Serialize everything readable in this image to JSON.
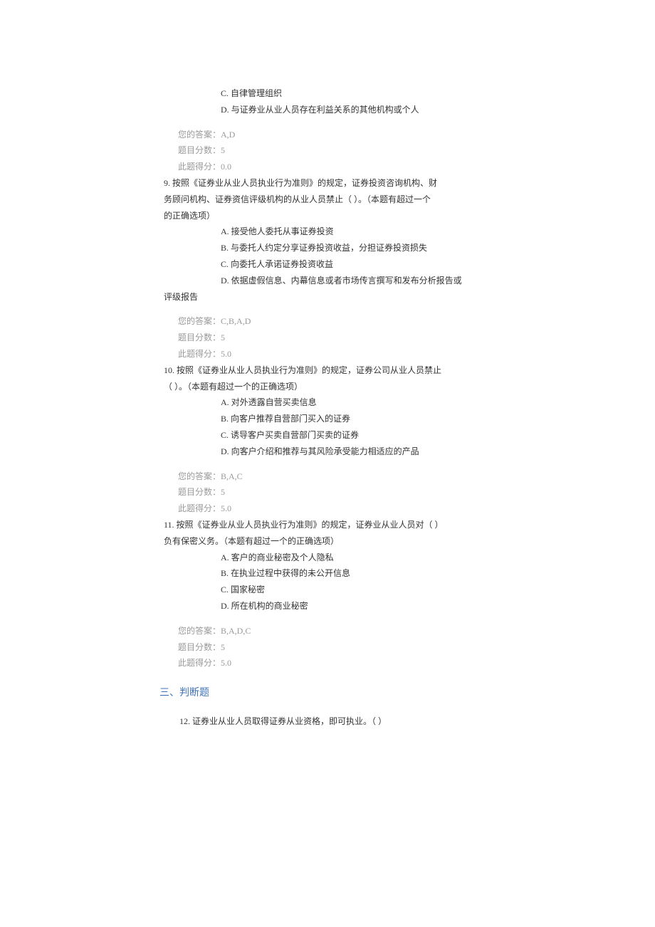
{
  "labels": {
    "your_answer": "您的答案：",
    "question_score": "题目分数：",
    "this_score": "此题得分："
  },
  "q_top_options": {
    "c": "C. 自律管理组织",
    "d": "D. 与证券业从业人员存在利益关系的其他机构或个人"
  },
  "q_top_meta": {
    "answer": "A,D",
    "score": "5",
    "got": "0.0"
  },
  "q9": {
    "line1": "9. 按照《证券业从业人员执业行为准则》的规定，证券投资咨询机构、财",
    "line2": "务顾问机构、证券资信评级机构的从业人员禁止（ ）。（本题有超过一个",
    "line3": "的正确选项）",
    "a": "A. 接受他人委托从事证券投资",
    "b": "B. 与委托人约定分享证券投资收益，分担证券投资损失",
    "c": "C. 向委托人承诺证券投资收益",
    "d": "D. 依据虚假信息、内幕信息或者市场传言撰写和发布分析报告或",
    "d_cont": "评级报告",
    "answer": "C,B,A,D",
    "score": "5",
    "got": "5.0"
  },
  "q10": {
    "line1": "10. 按照《证券业从业人员执业行为准则》的规定，证券公司从业人员禁止",
    "line2": "（ ）。（本题有超过一个的正确选项）",
    "a": "A. 对外透露自营买卖信息",
    "b": "B. 向客户推荐自营部门买入的证券",
    "c": "C. 诱导客户买卖自营部门买卖的证券",
    "d": "D. 向客户介绍和推荐与其风险承受能力相适应的产品",
    "answer": "B,A,C",
    "score": "5",
    "got": "5.0"
  },
  "q11": {
    "line1": "11. 按照《证券业从业人员执业行为准则》的规定，证券业从业人员对（  ）",
    "line2": "负有保密义务。（本题有超过一个的正确选项）",
    "a": "A. 客户的商业秘密及个人隐私",
    "b": "B. 在执业过程中获得的未公开信息",
    "c": "C. 国家秘密",
    "d": "D. 所在机构的商业秘密",
    "answer": "B,A,D,C",
    "score": "5",
    "got": "5.0"
  },
  "section3": "三、判断题",
  "q12": {
    "text": "12. 证券业从业人员取得证券从业资格，即可执业。（ ）"
  }
}
